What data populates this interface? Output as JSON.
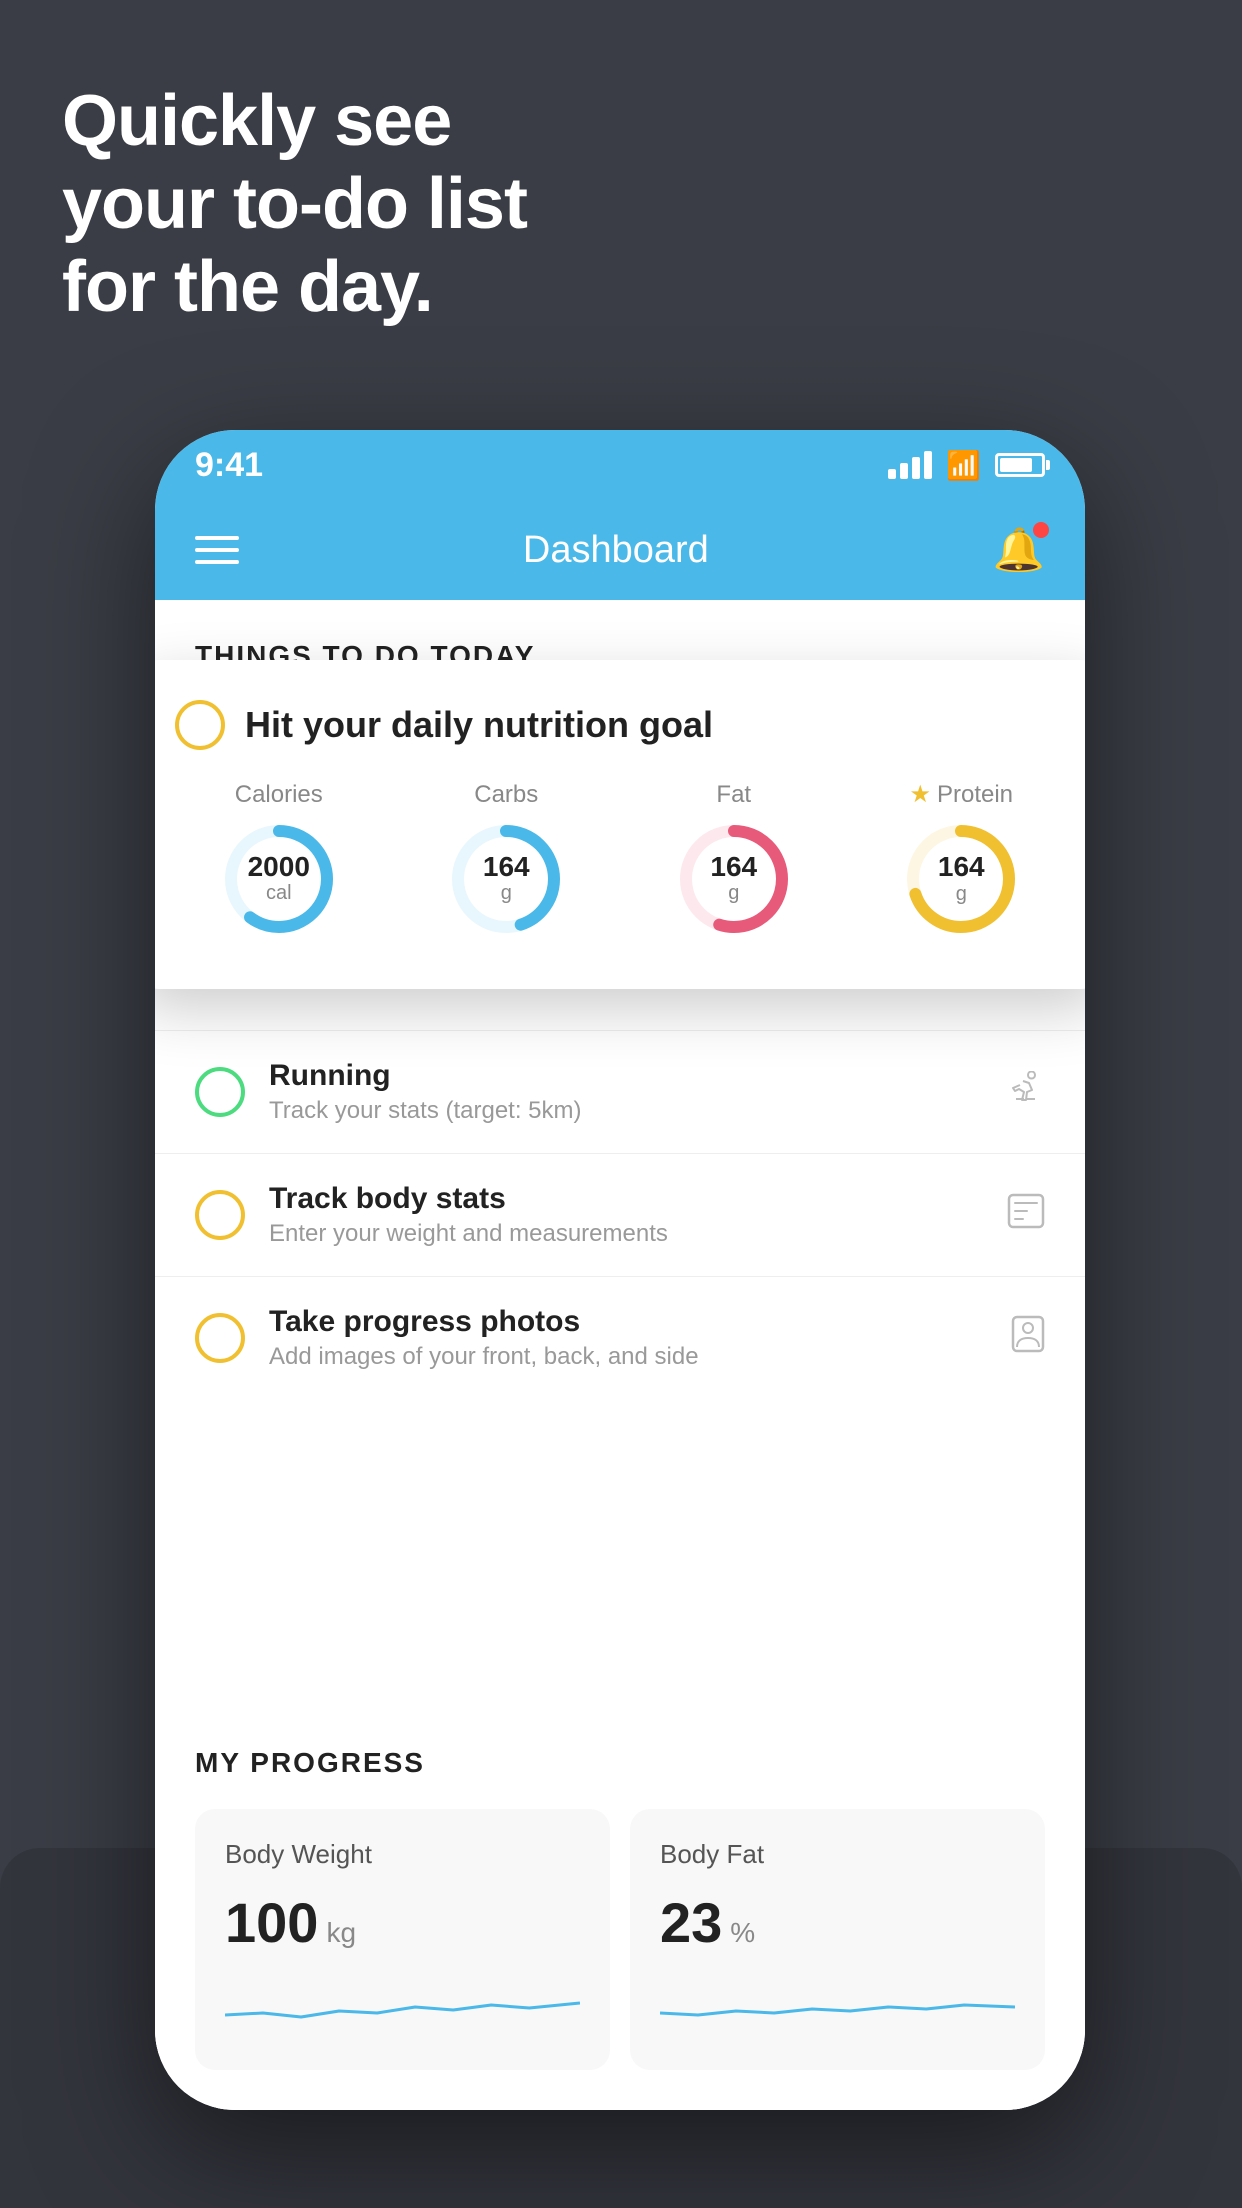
{
  "hero": {
    "line1": "Quickly see",
    "line2": "your to-do list",
    "line3": "for the day."
  },
  "phone": {
    "status_bar": {
      "time": "9:41"
    },
    "header": {
      "title": "Dashboard"
    },
    "section_title": "THINGS TO DO TODAY",
    "floating_card": {
      "title": "Hit your daily nutrition goal",
      "nutrients": [
        {
          "label": "Calories",
          "value": "2000",
          "unit": "cal",
          "color": "#4ab8e8",
          "bg_color": "#e8f7fd",
          "percent": 60
        },
        {
          "label": "Carbs",
          "value": "164",
          "unit": "g",
          "color": "#4ab8e8",
          "bg_color": "#e8f7fd",
          "percent": 45
        },
        {
          "label": "Fat",
          "value": "164",
          "unit": "g",
          "color": "#e85a7a",
          "bg_color": "#fde8ed",
          "percent": 55
        },
        {
          "label": "Protein",
          "value": "164",
          "unit": "g",
          "color": "#f0c030",
          "bg_color": "#fdf6e3",
          "percent": 70,
          "starred": true
        }
      ]
    },
    "todo_items": [
      {
        "title": "Running",
        "subtitle": "Track your stats (target: 5km)",
        "circle_color": "green",
        "icon": "👟"
      },
      {
        "title": "Track body stats",
        "subtitle": "Enter your weight and measurements",
        "circle_color": "yellow",
        "icon": "⊞"
      },
      {
        "title": "Take progress photos",
        "subtitle": "Add images of your front, back, and side",
        "circle_color": "yellow",
        "icon": "👤"
      }
    ],
    "progress": {
      "section_title": "MY PROGRESS",
      "cards": [
        {
          "title": "Body Weight",
          "value": "100",
          "unit": "kg"
        },
        {
          "title": "Body Fat",
          "value": "23",
          "unit": "%"
        }
      ]
    }
  }
}
